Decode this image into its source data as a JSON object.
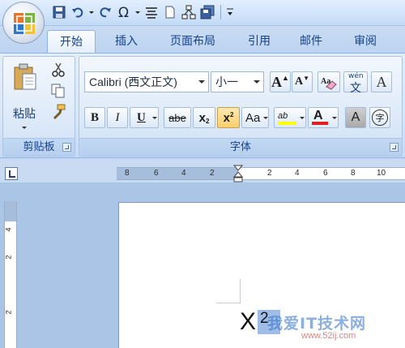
{
  "tabs": [
    {
      "label": "开始",
      "active": true
    },
    {
      "label": "插入"
    },
    {
      "label": "页面布局"
    },
    {
      "label": "引用"
    },
    {
      "label": "邮件"
    },
    {
      "label": "审阅"
    }
  ],
  "clipboard": {
    "paste_label": "粘贴",
    "group_label": "剪贴板"
  },
  "font": {
    "font_name": "Calibri (西文正文)",
    "font_size": "小一",
    "group_label": "字体",
    "bold": "B",
    "italic": "I",
    "underline": "U",
    "strike": "abe",
    "subscript": "x",
    "subscript_mark": "2",
    "superscript": "x",
    "superscript_mark": "2",
    "change_case": "Aa",
    "grow_font": "A",
    "shrink_font": "A",
    "font_color": "A",
    "char_shade": "A",
    "enclose_char": "字",
    "highlight": "ab",
    "phonetic_top": "wén",
    "phonetic_char": "文",
    "clear_format": "A"
  },
  "ruler": {
    "h_numbers": [
      "8",
      "6",
      "4",
      "2",
      "2",
      "4",
      "6",
      "8",
      "10"
    ],
    "v_numbers": [
      "4",
      "2",
      "2"
    ]
  },
  "document": {
    "base": "X",
    "sup": "2"
  },
  "watermark": {
    "main": "我爱IT技术网",
    "sub": "www.52ij.com"
  },
  "colors": {
    "accent": "#15428b",
    "font_color_bar": "#e02020",
    "highlight_bar": "#ffff00",
    "selection": "#9fbde6"
  }
}
